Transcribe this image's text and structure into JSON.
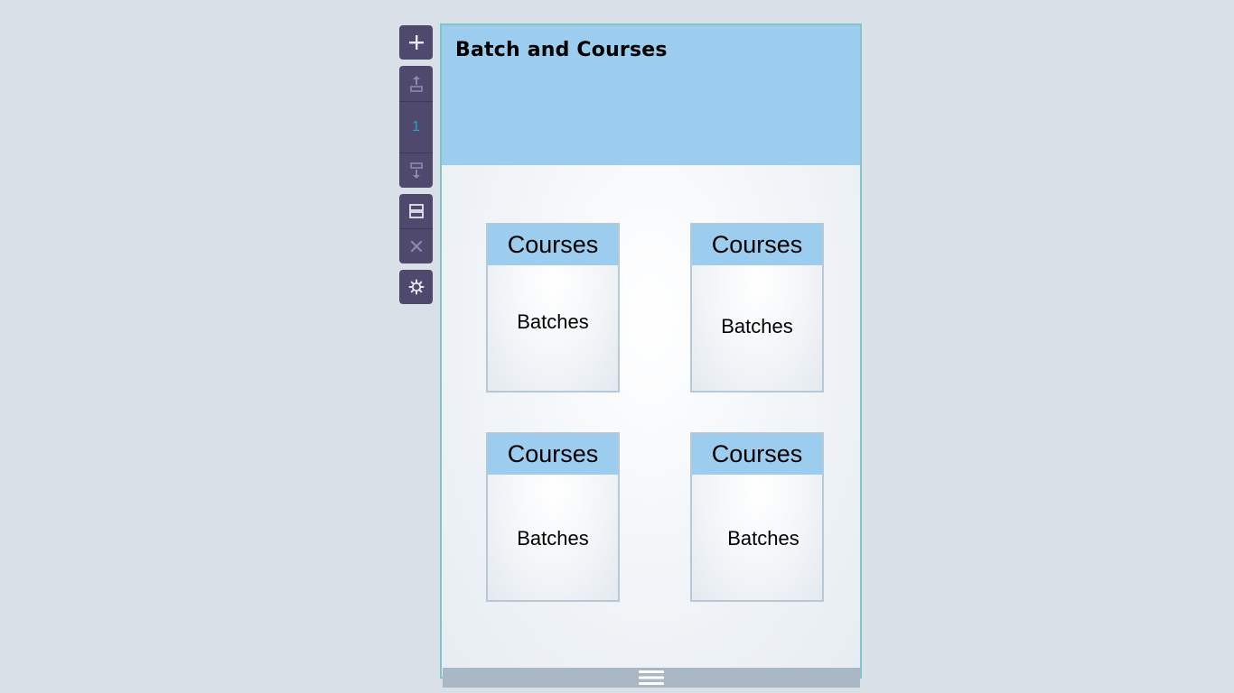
{
  "toolbar": {
    "items": [
      {
        "name": "add-section",
        "icon": "plus-icon"
      },
      {
        "name": "move-up",
        "icon": "move-up-icon"
      },
      {
        "name": "section-number",
        "value": "1"
      },
      {
        "name": "move-down",
        "icon": "move-down-icon"
      },
      {
        "name": "layout",
        "icon": "layout-rows-icon"
      },
      {
        "name": "delete",
        "icon": "close-icon"
      },
      {
        "name": "settings",
        "icon": "gear-icon"
      }
    ],
    "section_number": "1"
  },
  "page": {
    "title": "Batch and Courses",
    "header_color": "#9ccdee",
    "border_color": "#7fc6c6"
  },
  "cards": [
    {
      "title": "Courses",
      "body": "Batches"
    },
    {
      "title": "Courses",
      "body": "Batches"
    },
    {
      "title": "Courses",
      "body": "Batches"
    },
    {
      "title": "Courses",
      "body": "Batches"
    }
  ],
  "bottom_bar": {
    "icon": "hamburger-handle-icon",
    "color": "#aab8c6"
  },
  "colors": {
    "background": "#d9e0e8",
    "toolbar": "#4f4a6d",
    "accent_number": "#22a5c8"
  }
}
